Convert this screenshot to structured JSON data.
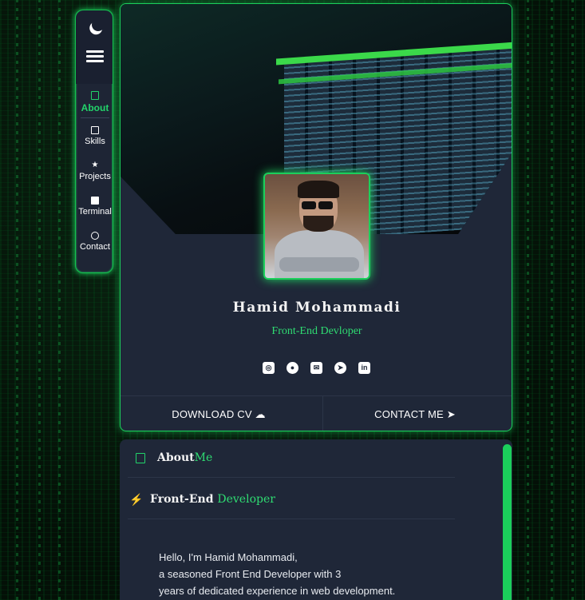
{
  "nav": {
    "items": [
      {
        "label": "About",
        "icon": "profile-icon",
        "active": true
      },
      {
        "label": "Skills",
        "icon": "profile-icon"
      },
      {
        "label": "Projects",
        "icon": "star-icon"
      },
      {
        "label": "Terminal",
        "icon": "terminal-icon"
      },
      {
        "label": "Contact",
        "icon": "chat-icon"
      }
    ]
  },
  "profile": {
    "name": "Hamid Mohammadi",
    "role": "Front-End Devloper",
    "socials": [
      "instagram-icon",
      "github-icon",
      "mail-icon",
      "telegram-icon",
      "linkedin-icon"
    ]
  },
  "actions": {
    "download_cv": "DOWNLOAD CV",
    "contact_me": "CONTACT ME"
  },
  "about": {
    "title_main": "About",
    "title_accent": "Me",
    "subtitle_main": "Front-End",
    "subtitle_accent": "Developer",
    "lines": [
      "Hello, I'm Hamid Mohammadi,",
      "a seasoned Front End Developer with 3",
      "years of dedicated experience in web development."
    ]
  },
  "colors": {
    "accent": "#22d36a",
    "card": "#1f2738",
    "background": "#050a06"
  }
}
